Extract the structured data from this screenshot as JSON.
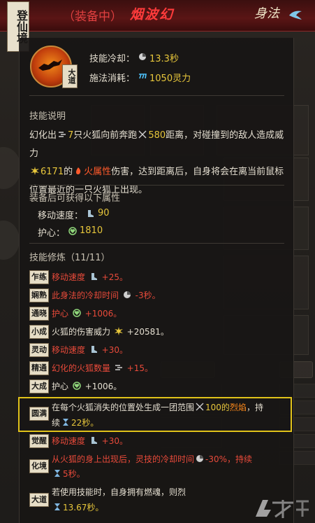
{
  "realm": "登仙境",
  "header": {
    "equipped_state": "（装备中）",
    "skill_name": "烟波幻",
    "category": "身法"
  },
  "skill": {
    "badge": "大道",
    "cooldown_label": "技能冷却：",
    "cooldown_value": "13.3秒",
    "cost_label": "施法消耗：",
    "cost_value": "1050灵力"
  },
  "description": {
    "title": "技能说明",
    "p1": "幻化出",
    "n_foxes": "7",
    "p2": "只火狐向前奔跑",
    "distance": "580",
    "p3": "距离，对碰撞到的敌人造成威力",
    "power": "6171",
    "p4": "的",
    "element": "火属性",
    "p5": "伤害，达到距离后，自身将会在离当前鼠标位置最近的一只火狐上出现。"
  },
  "equip_bonus": {
    "title": "装备后可获得以下属性",
    "move_label": "移动速度：",
    "move_value": "90",
    "guard_label": "护心：",
    "guard_value": "1810"
  },
  "training": {
    "title": "技能修炼（11/11）",
    "tiers": [
      {
        "tag": "乍练",
        "a": "移动速度",
        "b": "+25。"
      },
      {
        "tag": "娴熟",
        "a": "此身法的冷却时间",
        "b": "-3秒。"
      },
      {
        "tag": "通晓",
        "a": "护心",
        "b": "+1006。"
      },
      {
        "tag": "小成",
        "a": "火狐的伤害威力",
        "b": "+20581。"
      },
      {
        "tag": "灵动",
        "a": "移动速度",
        "b": "+30。"
      },
      {
        "tag": "精通",
        "a": "幻化的火狐数量",
        "b": "+15。"
      },
      {
        "tag": "大成",
        "a": "护心",
        "b": "+1006。"
      }
    ],
    "yuanman": {
      "tag": "圆满",
      "l1a": "在每个火狐消失的位置处生成一团范围",
      "l1b": "100的",
      "l1c": "烈焰",
      "l1d": "，持",
      "l2a": "续",
      "l2b": "22秒。"
    },
    "juexing": {
      "tag": "觉醒",
      "a": "移动速度",
      "b": "+30。"
    },
    "huajing": {
      "tag": "化境",
      "l1a": "从火狐的身上出现后，灵技的冷却时间",
      "l1b": "-30%，持续",
      "l2": "5秒。"
    },
    "dadao": {
      "tag": "大道",
      "l1": "若使用技能时，自身拥有燃魂，则烈",
      "l2": "13.67秒。"
    }
  },
  "colors": {
    "accent_yellow": "#e7c63b",
    "accent_red": "#e84a3a",
    "highlight_border": "#e0c21a"
  }
}
